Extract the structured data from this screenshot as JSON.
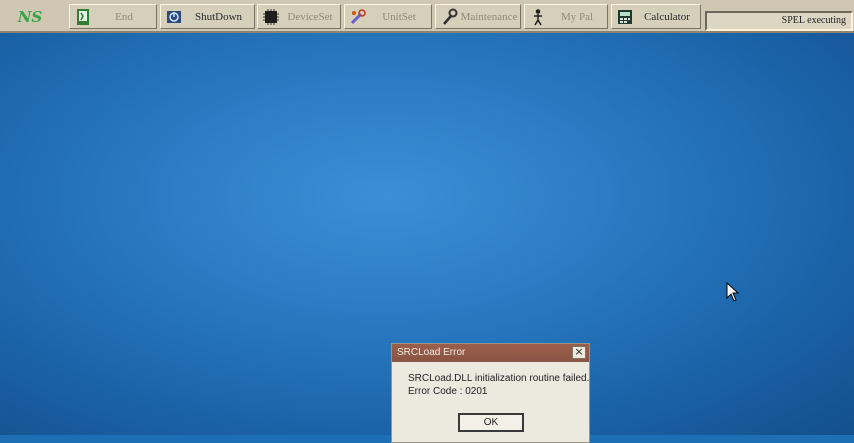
{
  "taskbar": {
    "logo": "NS",
    "buttons": [
      {
        "label": "End",
        "icon": "exit-door-icon",
        "enabled": false
      },
      {
        "label": "ShutDown",
        "icon": "power-icon",
        "enabled": true
      },
      {
        "label": "DeviceSet",
        "icon": "chip-icon",
        "enabled": false
      },
      {
        "label": "UnitSet",
        "icon": "tools-icon",
        "enabled": false
      },
      {
        "label": "Maintenance",
        "icon": "wrench-icon",
        "enabled": false
      },
      {
        "label": "My Pal",
        "icon": "person-icon",
        "enabled": false
      },
      {
        "label": "Calculator",
        "icon": "calculator-icon",
        "enabled": true
      }
    ],
    "status_text": "SPEL executing"
  },
  "dialog": {
    "title": "SRCLoad Error",
    "close_glyph": "×",
    "message_line1": "SRCLoad.DLL initialization routine failed.",
    "message_line2": "Error Code : 0201",
    "ok_label": "OK"
  },
  "colors": {
    "desktop": "#2a7bc3",
    "taskbar": "#cfc7b1",
    "dialog_title": "#8a5443",
    "logo": "#3aa24a"
  }
}
